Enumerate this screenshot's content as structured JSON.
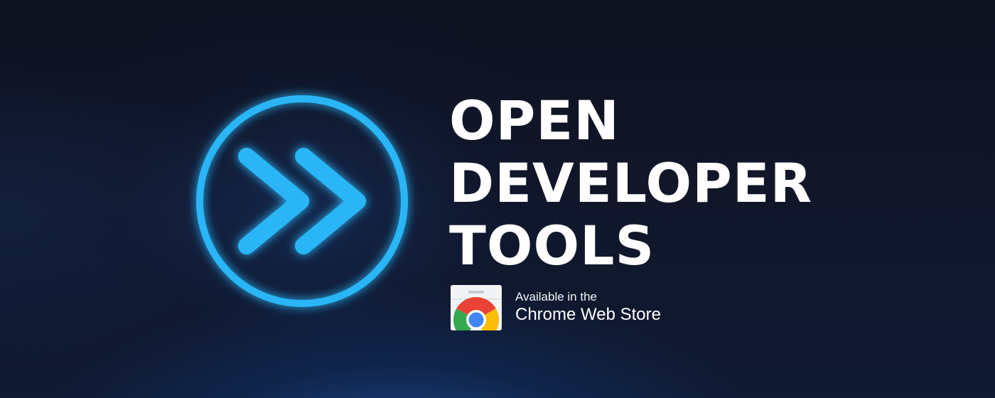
{
  "banner": {
    "title_lines": [
      "OPEN",
      "DEVELOPER",
      "TOOLS"
    ],
    "logo_icon": "double-chevron-right-circle-icon",
    "accent_color": "#29b6f6",
    "background_color": "#10152a"
  },
  "store_badge": {
    "icon": "chrome-web-store-icon",
    "line1": "Available in the",
    "line2": "Chrome Web Store"
  }
}
